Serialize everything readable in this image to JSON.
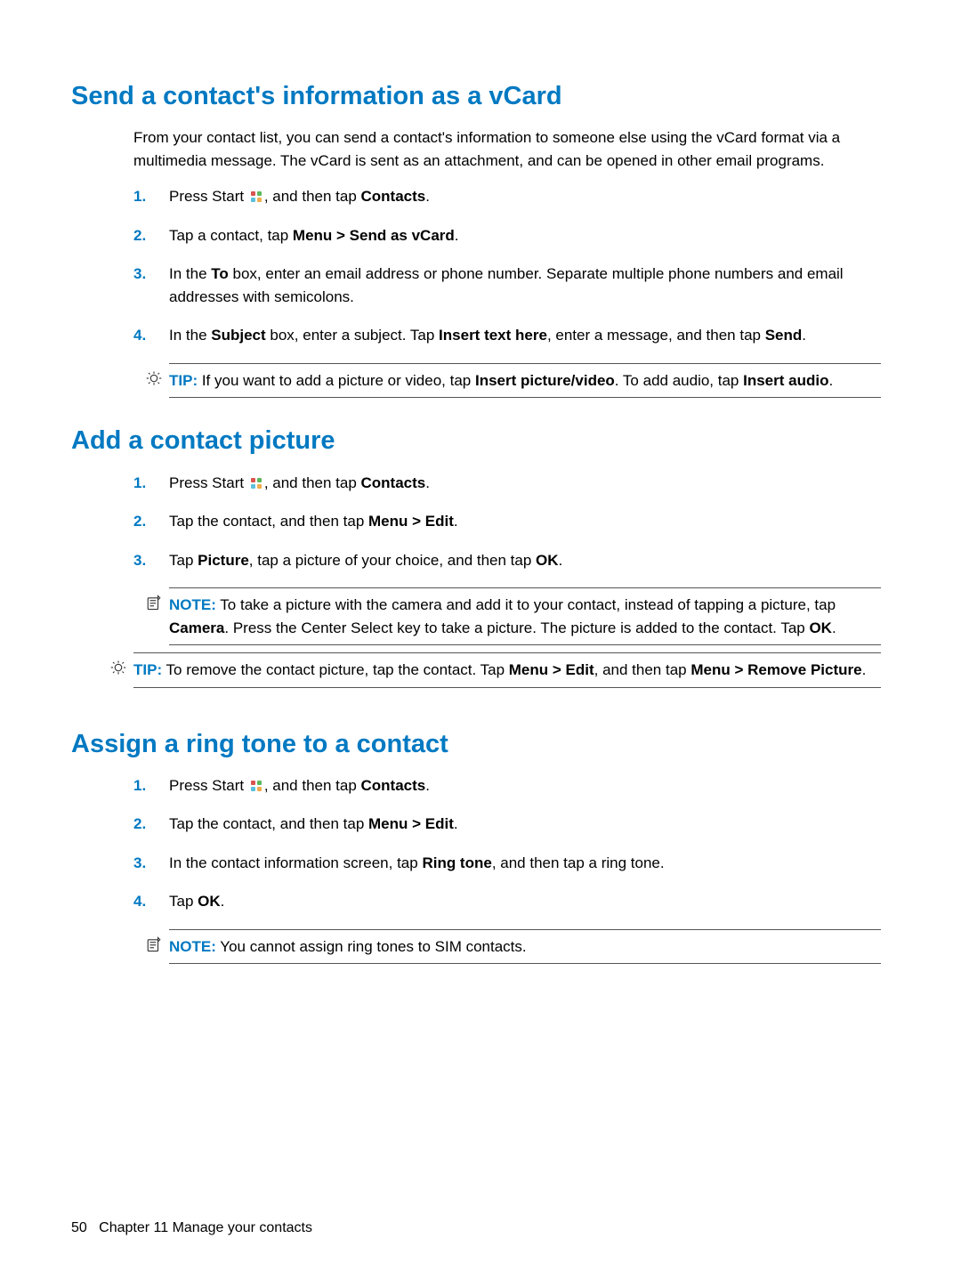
{
  "sections": {
    "s1": {
      "title": "Send a contact's information as a vCard",
      "intro": "From your contact list, you can send a contact's information to someone else using the vCard format via a multimedia message. The vCard is sent as an attachment, and can be opened in other email programs.",
      "step1_a": "Press Start ",
      "step1_b": ", and then tap ",
      "step1_c": "Contacts",
      "step1_d": ".",
      "step2_a": "Tap a contact, tap ",
      "step2_b": "Menu > Send as vCard",
      "step2_c": ".",
      "step3_a": "In the ",
      "step3_b": "To",
      "step3_c": " box, enter an email address or phone number. Separate multiple phone numbers and email addresses with semicolons.",
      "step4_a": "In the ",
      "step4_b": "Subject",
      "step4_c": " box, enter a subject. Tap ",
      "step4_d": "Insert text here",
      "step4_e": ", enter a message, and then tap ",
      "step4_f": "Send",
      "step4_g": ".",
      "tip_label": "TIP:",
      "tip_a": " If you want to add a picture or video, tap ",
      "tip_b": "Insert picture/video",
      "tip_c": ". To add audio, tap ",
      "tip_d": "Insert audio",
      "tip_e": "."
    },
    "s2": {
      "title": "Add a contact picture",
      "step1_a": "Press Start ",
      "step1_b": ", and then tap ",
      "step1_c": "Contacts",
      "step1_d": ".",
      "step2_a": "Tap the contact, and then tap ",
      "step2_b": "Menu > Edit",
      "step2_c": ".",
      "step3_a": "Tap ",
      "step3_b": "Picture",
      "step3_c": ", tap a picture of your choice, and then tap ",
      "step3_d": "OK",
      "step3_e": ".",
      "note_label": "NOTE:",
      "note_a": " To take a picture with the camera and add it to your contact, instead of tapping a picture, tap ",
      "note_b": "Camera",
      "note_c": ". Press the Center Select key to take a picture. The picture is added to the contact. Tap ",
      "note_d": "OK",
      "note_e": ".",
      "tip_label": "TIP:",
      "tip_a": " To remove the contact picture, tap the contact. Tap ",
      "tip_b": "Menu > Edit",
      "tip_c": ", and then tap ",
      "tip_d": "Menu > Remove Picture",
      "tip_e": "."
    },
    "s3": {
      "title": "Assign a ring tone to a contact",
      "step1_a": "Press Start ",
      "step1_b": ", and then tap ",
      "step1_c": "Contacts",
      "step1_d": ".",
      "step2_a": "Tap the contact, and then tap ",
      "step2_b": "Menu > Edit",
      "step2_c": ".",
      "step3_a": "In the contact information screen, tap ",
      "step3_b": "Ring tone",
      "step3_c": ", and then tap a ring tone.",
      "step4_a": "Tap ",
      "step4_b": "OK",
      "step4_c": ".",
      "note_label": "NOTE:",
      "note_a": " You cannot assign ring tones to SIM contacts."
    }
  },
  "labels": {
    "n1": "1.",
    "n2": "2.",
    "n3": "3.",
    "n4": "4."
  },
  "footer": {
    "page": "50",
    "chapter": "Chapter 11   Manage your contacts"
  }
}
